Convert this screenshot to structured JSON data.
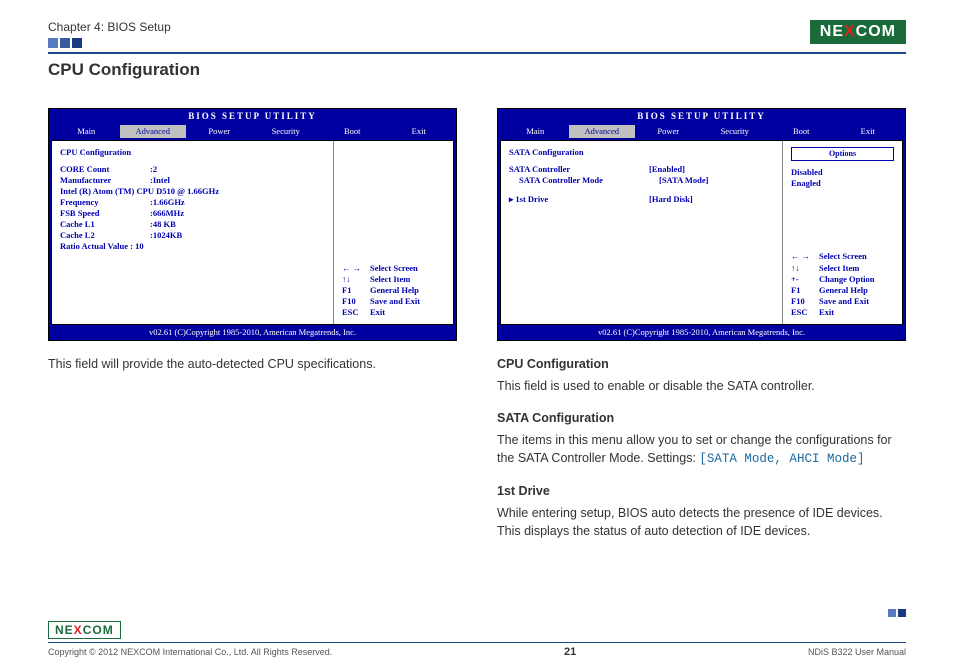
{
  "header": {
    "chapter": "Chapter 4: BIOS Setup",
    "logo_text": "NEXCOM"
  },
  "section_title": "CPU Configuration",
  "bios_common": {
    "utility_title": "BIOS  SETUP  UTILITY",
    "tabs": [
      "Main",
      "Advanced",
      "Power",
      "Security",
      "Boot",
      "Exit"
    ],
    "active_tab": "Advanced",
    "footer": "v02.61 (C)Copyright 1985-2010, American Megatrends, Inc."
  },
  "bios1": {
    "heading": "CPU Configuration",
    "lines": [
      {
        "lbl": "CORE Count",
        "val": ":2"
      },
      {
        "lbl": "Manufacturer",
        "val": ":Intel"
      },
      {
        "full": "Intel (R)   Atom (TM)   CPU   D510       @ 1.66GHz"
      },
      {
        "lbl": "Frequency",
        "val": ":1.66GHz"
      },
      {
        "lbl": "FSB  Speed",
        "val": ":666MHz"
      },
      {
        "lbl": "Cache  L1",
        "val": ":48 KB"
      },
      {
        "lbl": "Cache  L2",
        "val": ":1024KB"
      },
      {
        "full": "Ratio  Actual   Value : 10"
      }
    ],
    "help": [
      {
        "k": "← →",
        "t": "Select Screen"
      },
      {
        "k": "↑↓",
        "t": "Select Item"
      },
      {
        "k": "F1",
        "t": "General Help"
      },
      {
        "k": "F10",
        "t": "Save and Exit"
      },
      {
        "k": "ESC",
        "t": "Exit"
      }
    ]
  },
  "bios2": {
    "heading": "SATA  Configuration",
    "rows": [
      {
        "lbl": "SATA   Controller",
        "val": "[Enabled]",
        "indent": false
      },
      {
        "lbl": "SATA  Controller  Mode",
        "val": "[SATA  Mode]",
        "indent": true
      },
      {
        "spacer": true
      },
      {
        "lbl": "▸  1st  Drive",
        "val": "[Hard  Disk]",
        "indent": false
      }
    ],
    "options_title": "Options",
    "options": [
      "Disabled",
      "Enagled"
    ],
    "help": [
      {
        "k": "← →",
        "t": "Select Screen"
      },
      {
        "k": "↑↓",
        "t": "Select Item"
      },
      {
        "k": "+-",
        "t": "Change Option"
      },
      {
        "k": "F1",
        "t": "General Help"
      },
      {
        "k": "F10",
        "t": "Save and Exit"
      },
      {
        "k": "ESC",
        "t": "Exit"
      }
    ]
  },
  "left_desc": "This field will provide the auto-detected CPU specifications.",
  "right": {
    "h1": "CPU Configuration",
    "p1": "This field is used to enable or disable the SATA controller.",
    "h2": "SATA Configuration",
    "p2a": "The items in this menu allow you to set or change the configurations for the SATA Controller Mode. Settings: ",
    "p2b": "[SATA Mode, AHCI Mode]",
    "h3": "1st Drive",
    "p3": "While entering setup, BIOS auto detects the presence of IDE devices. This displays the status of auto detection of IDE devices."
  },
  "footer": {
    "copyright": "Copyright © 2012 NEXCOM International Co., Ltd. All Rights Reserved.",
    "page": "21",
    "doc": "NDiS B322 User Manual"
  }
}
